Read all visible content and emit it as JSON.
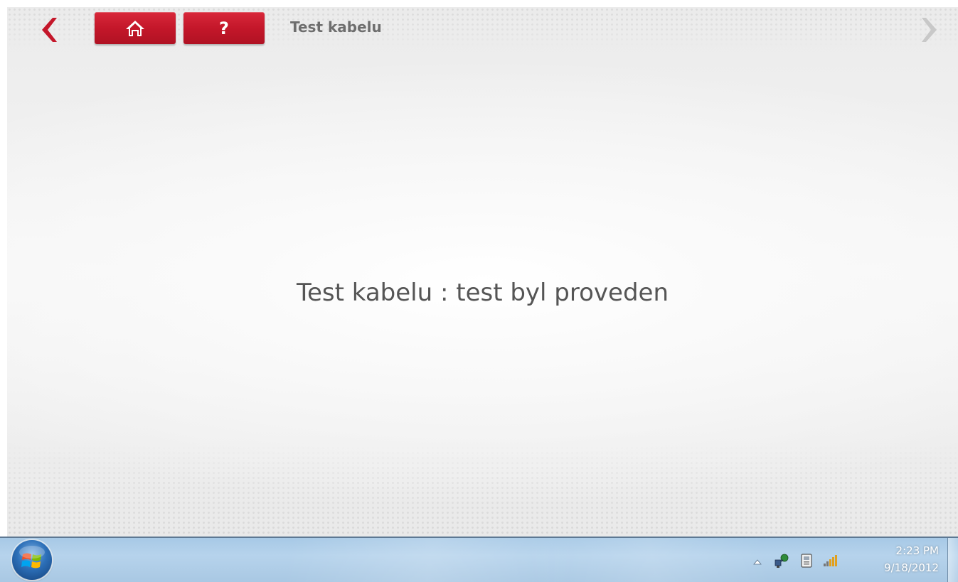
{
  "header": {
    "title": "Test kabelu",
    "back_icon": "chevron-left-icon",
    "forward_icon": "chevron-right-icon",
    "home_icon": "home-icon",
    "help_label": "?"
  },
  "main": {
    "message": "Test kabelu : test byl proveden"
  },
  "taskbar": {
    "start_icon": "windows-start-orb-icon",
    "tray_icons": [
      "chevron-up-icon",
      "network-icon",
      "device-icon",
      "signal-strength-icon"
    ],
    "time": "2:23 PM",
    "date": "9/18/2012"
  },
  "colors": {
    "accent_red": "#c4172a",
    "title_gray": "#6e6e6e",
    "message_gray": "#555555",
    "taskbar_blue": "#a9c8e3"
  }
}
